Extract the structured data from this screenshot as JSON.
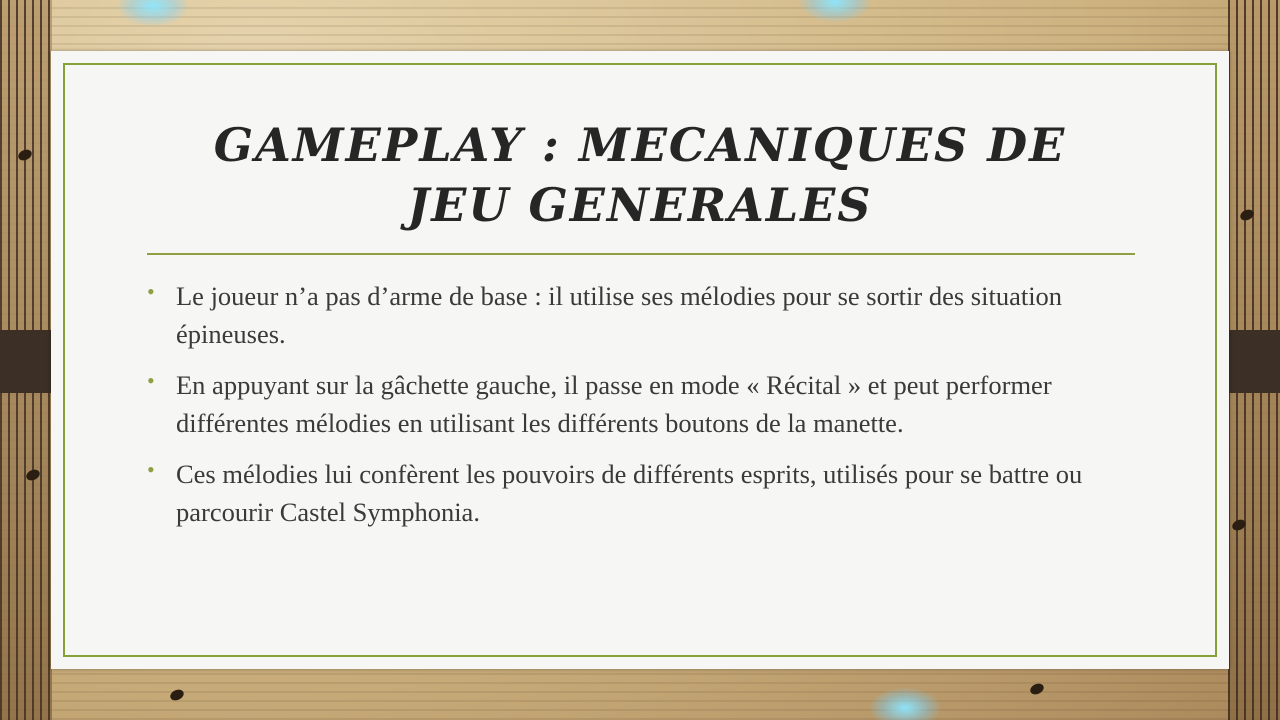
{
  "slide": {
    "title": "Gameplay : mecaniques de jeu generales",
    "bullets": [
      {
        "text": "Le joueur n’a pas d’arme de base : il utilise ses mélodies pour se sortir des situation épineuses."
      },
      {
        "text": "En appuyant sur la gâchette gauche, il passe en mode « Récital » et peut performer différentes mélodies en utilisant les différents boutons de la manette."
      },
      {
        "text": "Ces mélodies lui confèrent les pouvoirs de différents esprits, utilisés pour se battre ou parcourir Castel Symphonia."
      }
    ],
    "bullet_glyph": "•",
    "colors": {
      "accent": "#86a03a",
      "title_text": "#262626",
      "body_text": "#3a3a3a",
      "card_background": "#f6f6f4",
      "side_bars": "#3b2f26"
    }
  }
}
